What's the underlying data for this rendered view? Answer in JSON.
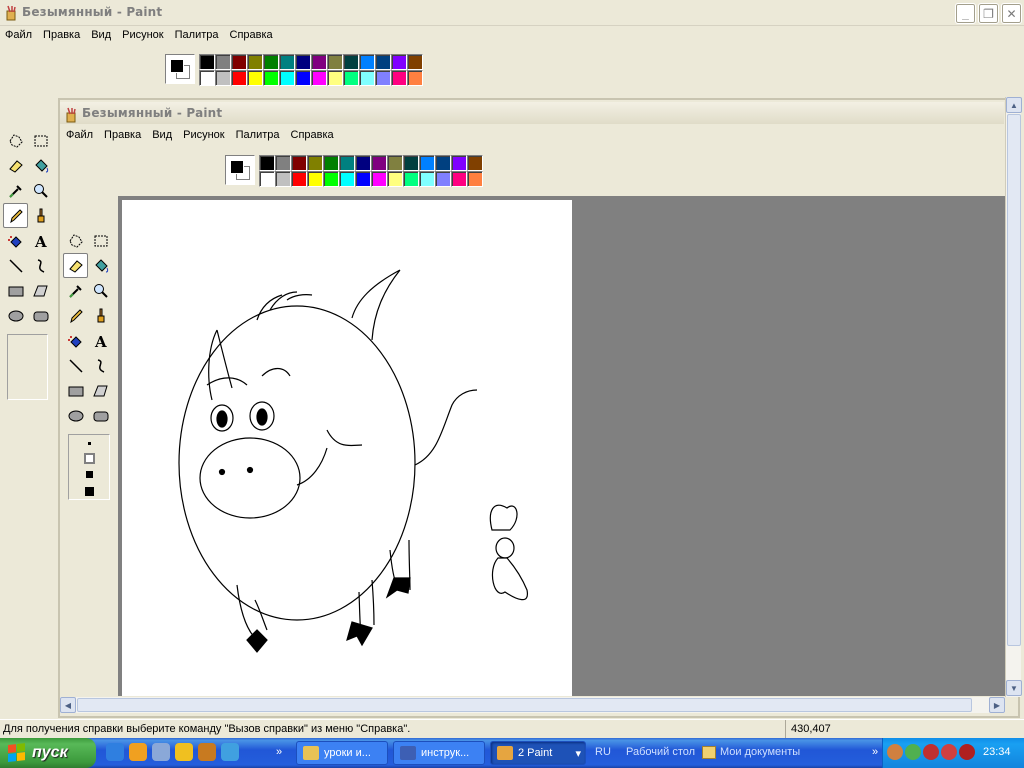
{
  "window": {
    "title": "Безымянный - Paint",
    "minimize_glyph": "_",
    "restore_glyph": "❐",
    "close_glyph": "✕"
  },
  "menu": [
    "Файл",
    "Правка",
    "Вид",
    "Рисунок",
    "Палитра",
    "Справка"
  ],
  "inner_window": {
    "title": "Безымянный - Paint"
  },
  "palette": {
    "foreground": "#000000",
    "background": "#ffffff",
    "colors": [
      "#000000",
      "#808080",
      "#800000",
      "#808000",
      "#008000",
      "#008080",
      "#000080",
      "#800080",
      "#808040",
      "#004040",
      "#0080ff",
      "#004080",
      "#8000ff",
      "#804000",
      "#ffffff",
      "#c0c0c0",
      "#ff0000",
      "#ffff00",
      "#00ff00",
      "#00ffff",
      "#0000ff",
      "#ff00ff",
      "#ffff80",
      "#00ff80",
      "#80ffff",
      "#8080ff",
      "#ff0080",
      "#ff8040"
    ]
  },
  "tools": [
    "free-select-icon",
    "rect-select-icon",
    "eraser-icon",
    "fill-icon",
    "picker-icon",
    "magnifier-icon",
    "pencil-icon",
    "brush-icon",
    "airbrush-icon",
    "text-icon",
    "line-icon",
    "curve-icon",
    "rectangle-icon",
    "polygon-icon",
    "ellipse-icon",
    "rounded-rect-icon"
  ],
  "status": {
    "help_text": "Для получения справки выберите команду \"Вызов справки\" из меню \"Справка\".",
    "coords": "430,407"
  },
  "taskbar": {
    "start_label": "пуск",
    "tasks": [
      {
        "label": "уроки и...",
        "color": "#e8c256"
      },
      {
        "label": "инструк...",
        "color": "#3d5fb4"
      },
      {
        "label": "2 Paint",
        "color": "#e6a540"
      }
    ],
    "lang": "RU",
    "desktop_label": "Рабочий стол",
    "docs_label": "Мои документы",
    "clock": "23:34"
  }
}
